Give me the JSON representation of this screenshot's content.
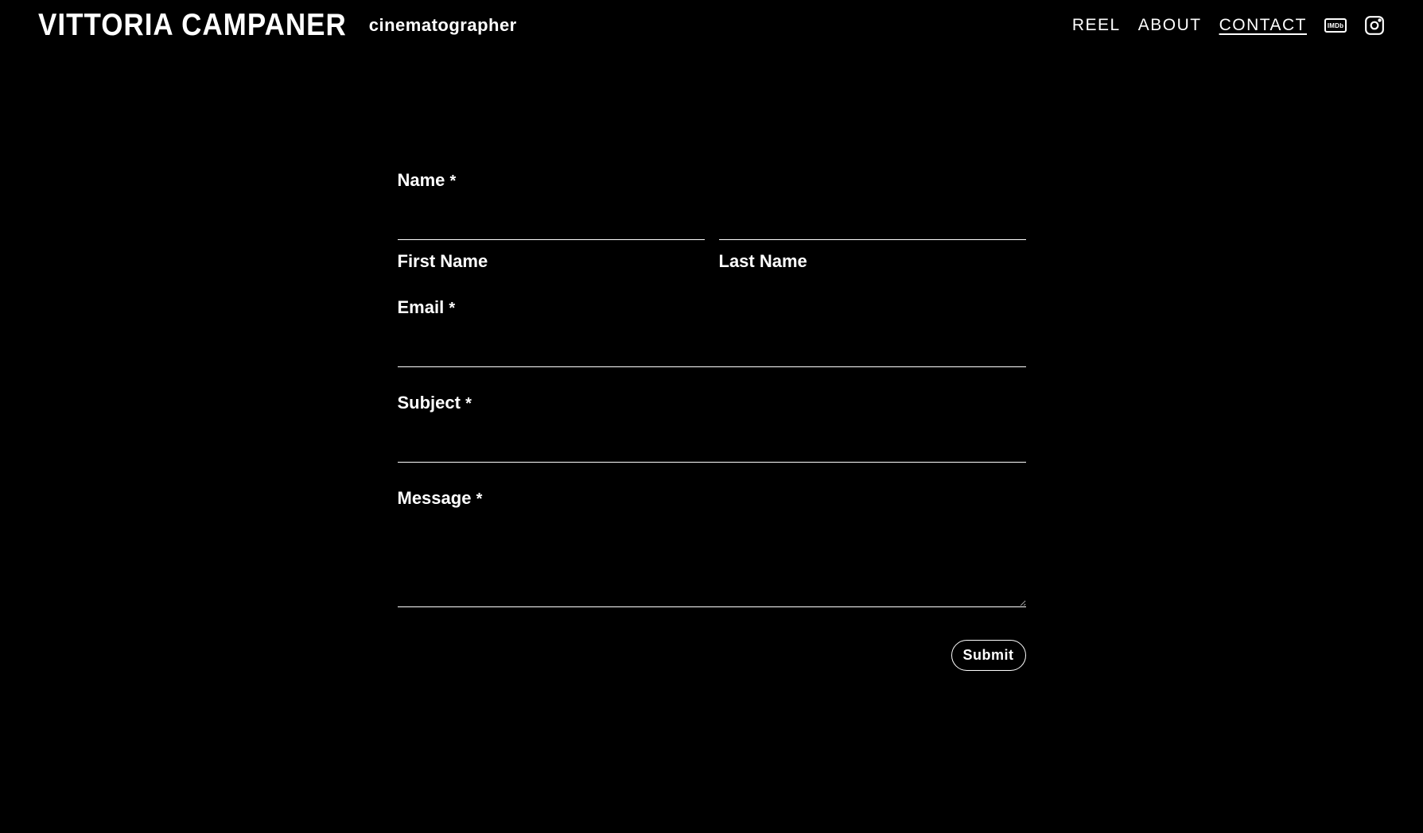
{
  "header": {
    "brand_name": "VITTORIA CAMPANER",
    "brand_subtitle": "cinematographer",
    "nav": {
      "reel": "REEL",
      "about": "ABOUT",
      "contact": "CONTACT"
    },
    "icons": {
      "imdb": "IMDb",
      "instagram": "Instagram"
    }
  },
  "form": {
    "name_label": "Name",
    "first_name_label": "First Name",
    "last_name_label": "Last Name",
    "email_label": "Email",
    "subject_label": "Subject",
    "message_label": "Message",
    "required_marker": "*",
    "submit_label": "Submit",
    "values": {
      "first_name": "",
      "last_name": "",
      "email": "",
      "subject": "",
      "message": ""
    }
  }
}
